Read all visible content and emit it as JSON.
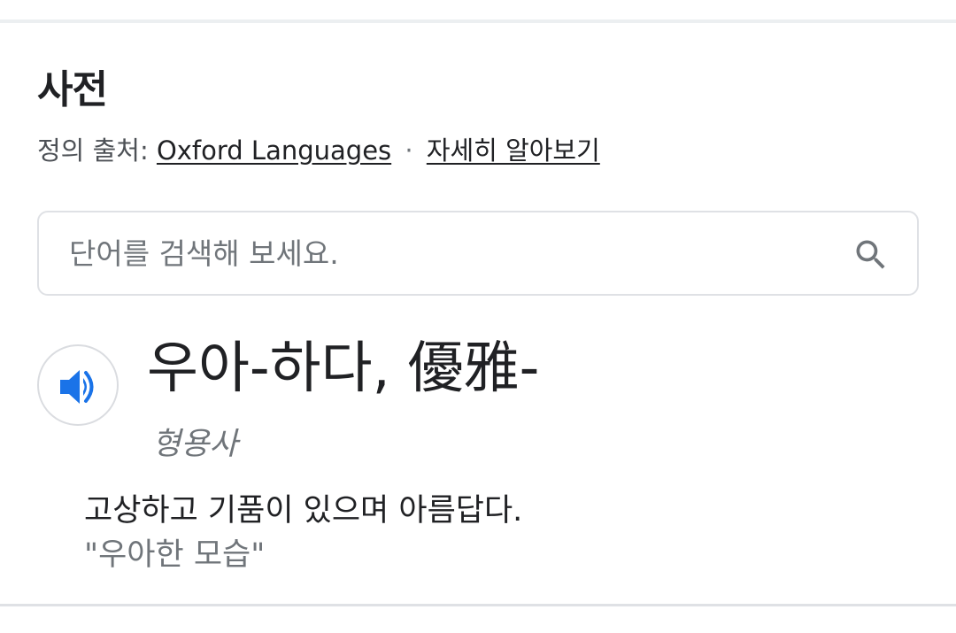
{
  "dictionary": {
    "title": "사전",
    "source_prefix": "정의 출처:",
    "source_link": "Oxford Languages",
    "separator": "·",
    "learn_more": "자세히 알아보기",
    "search": {
      "placeholder": "단어를 검색해 보세요.",
      "value": "",
      "icon": "search-icon"
    },
    "entry": {
      "speaker_icon": "speaker-icon",
      "headword": "우아-하다, 優雅-",
      "part_of_speech": "형용사",
      "definition": "고상하고 기품이 있으며 아름답다.",
      "example": "\"우아한 모습\""
    }
  },
  "colors": {
    "accent_blue": "#1a73e8",
    "text_primary": "#202124",
    "text_secondary": "#70757a",
    "border": "#dfe1e5"
  }
}
